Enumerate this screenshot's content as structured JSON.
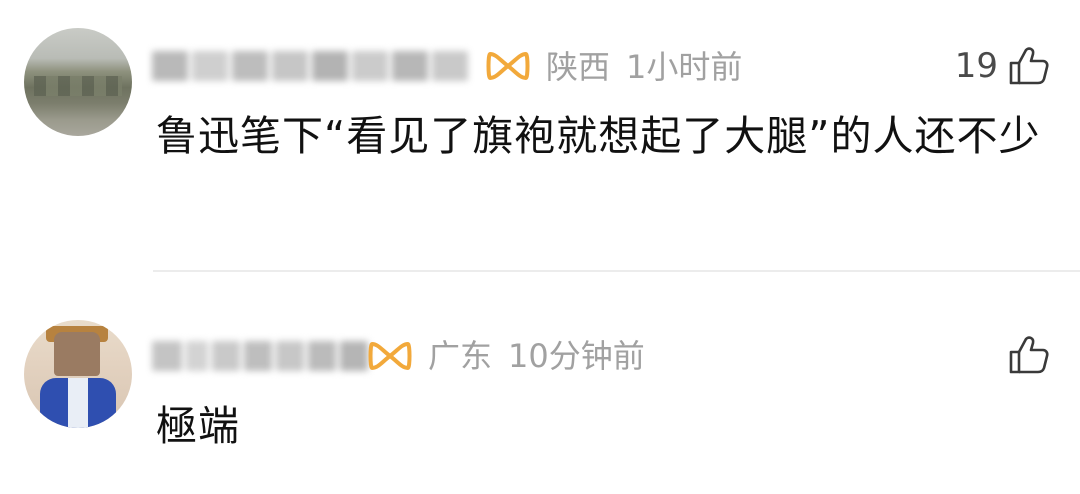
{
  "comments": [
    {
      "region": "陕西",
      "time": "1小时前",
      "likes": "19",
      "text": "鲁迅笔下“看见了旗袍就想起了大腿”的人还不少"
    },
    {
      "region": "广东",
      "time": "10分钟前",
      "likes": "",
      "text": "極端"
    }
  ],
  "colors": {
    "meta": "#a1a1a1",
    "text": "#111111",
    "svip_badge": "#f2a93b",
    "divider": "#ececec"
  },
  "icons": [
    "avatar",
    "svip-badge-icon",
    "thumb-up-icon"
  ]
}
